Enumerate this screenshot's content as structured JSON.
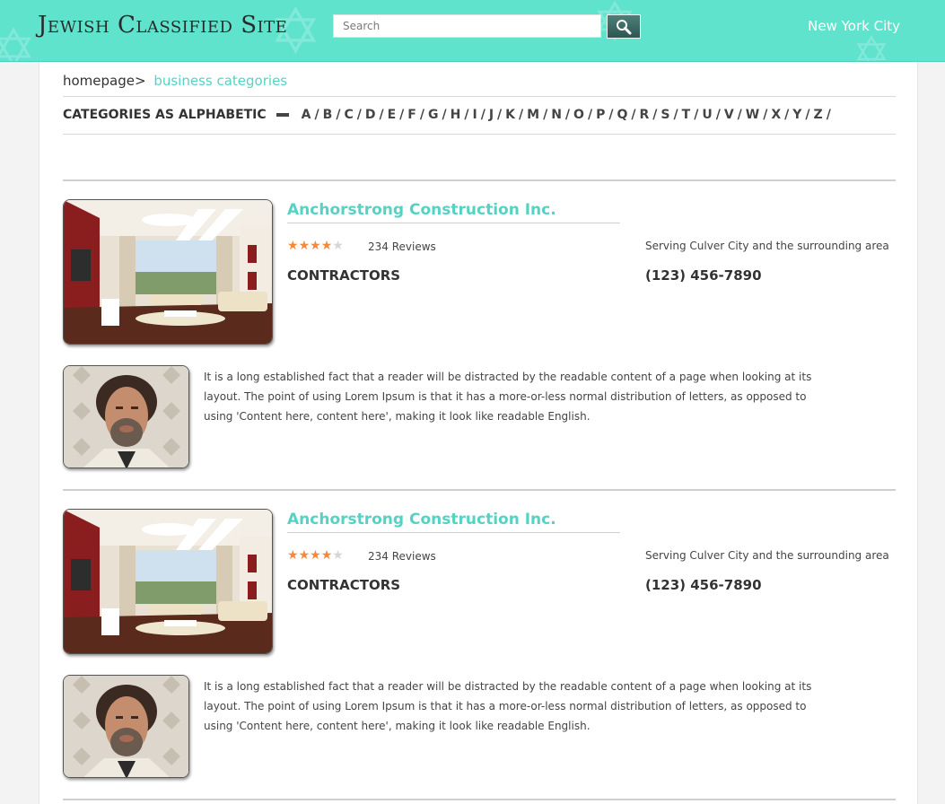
{
  "header": {
    "logo_text": "Jewish Classified Site",
    "search_placeholder": "Search",
    "city": "New York City",
    "colors": {
      "header_bg": "#5fe3cd",
      "accent": "#56d2c4",
      "search_button": "#3b6762"
    }
  },
  "breadcrumb": {
    "home": "homepage>",
    "current": "business categories"
  },
  "alphabet": {
    "label": "CATEGORIES AS ALPHABETIC",
    "letters": [
      "A",
      "B",
      "C",
      "D",
      "E",
      "F",
      "G",
      "H",
      "I",
      "J",
      "K",
      "M",
      "N",
      "O",
      "P",
      "Q",
      "R",
      "S",
      "T",
      "U",
      "V",
      "W",
      "X",
      "Y",
      "Z"
    ]
  },
  "listings": [
    {
      "title": "Anchorstrong Construction Inc.",
      "rating": 4,
      "rating_max": 5,
      "reviews": "234 Reviews",
      "category": "CONTRACTORS",
      "serving": "Serving Culver City and the surrounding area",
      "phone": "(123) 456-7890",
      "description": "It is a long established fact that a reader will be distracted by the readable content of a page when looking at its layout. The point of using Lorem Ipsum is that it has a more-or-less normal distribution of letters, as opposed to using 'Content here, content here', making it look like readable English."
    },
    {
      "title": "Anchorstrong Construction Inc.",
      "rating": 4,
      "rating_max": 5,
      "reviews": "234 Reviews",
      "category": "CONTRACTORS",
      "serving": "Serving Culver City and the surrounding area",
      "phone": "(123) 456-7890",
      "description": "It is a long established fact that a reader will be distracted by the readable content of a page when looking at its layout. The point of using Lorem Ipsum is that it has a more-or-less normal distribution of letters, as opposed to using 'Content here, content here', making it look like readable English."
    }
  ]
}
